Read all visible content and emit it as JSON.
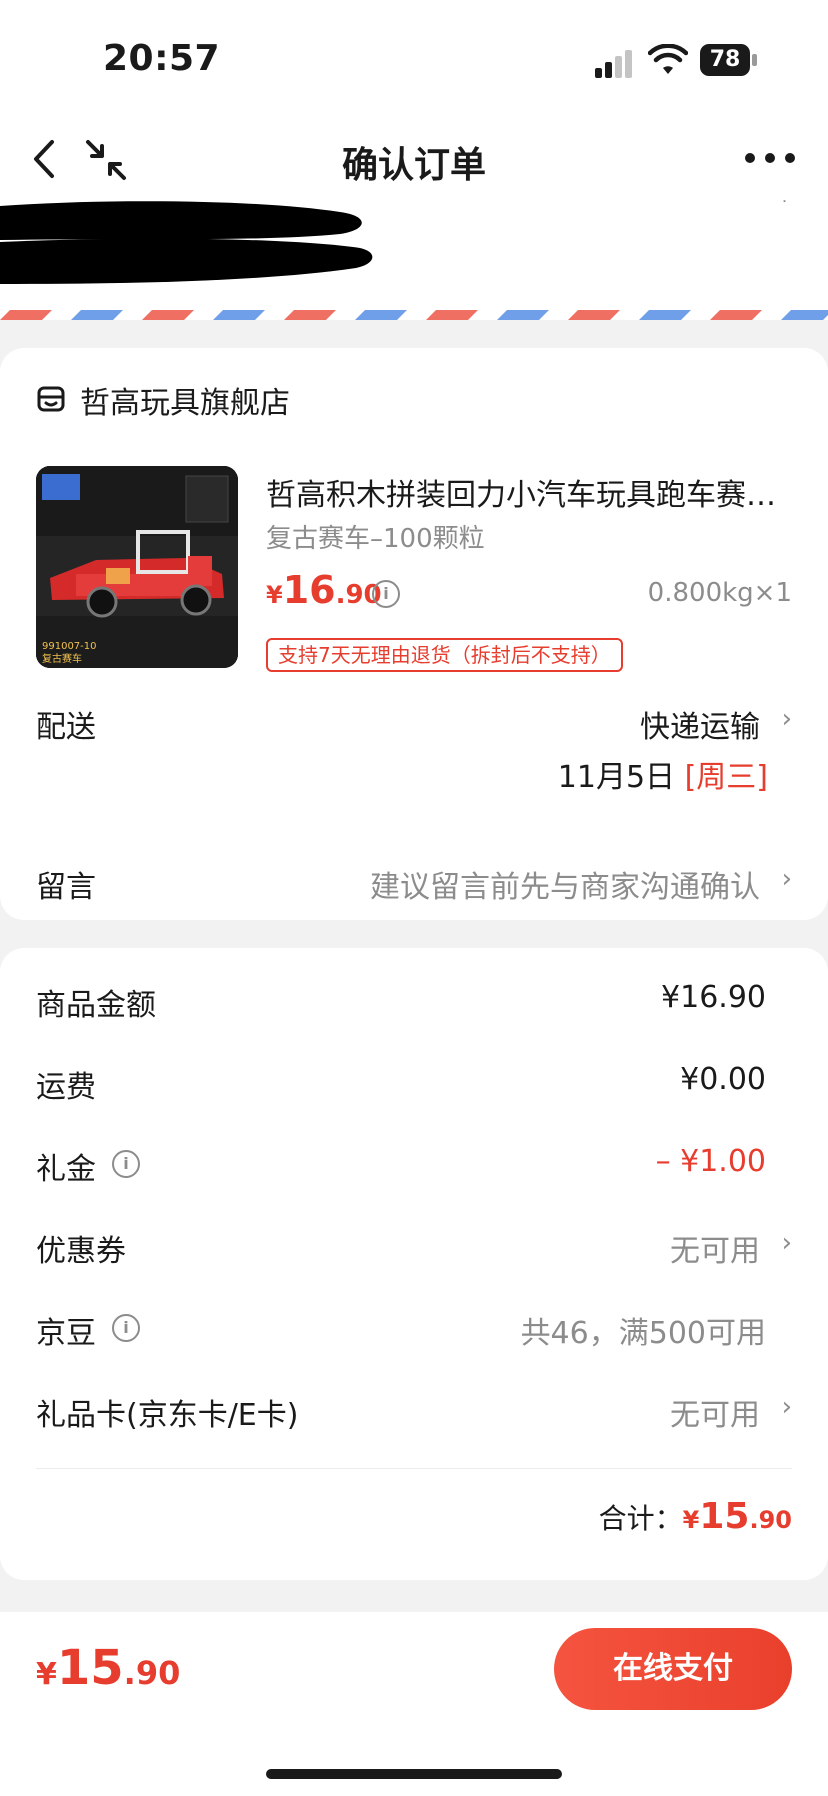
{
  "status_bar": {
    "time": "20:57",
    "battery": "78"
  },
  "header": {
    "title": "确认订单"
  },
  "shop": {
    "name": "哲高玩具旗舰店"
  },
  "product": {
    "title": "哲高积木拼装回力小汽车玩具跑车赛…",
    "spec": "复古赛车–100颗粒",
    "price_symbol": "¥",
    "price_int": "16",
    "price_dec": ".90",
    "weight_qty": "0.800kg×1",
    "return_policy": "支持7天无理由退货（拆封后不支持）",
    "image_text": {
      "code": "991007-10",
      "name": "复古赛车"
    }
  },
  "delivery": {
    "label": "配送",
    "method": "快递运输",
    "date": "11月5日",
    "weekday": "[周三]"
  },
  "message": {
    "label": "留言",
    "hint": "建议留言前先与商家沟通确认"
  },
  "summary": {
    "goods_amount": {
      "label": "商品金额",
      "value": "¥16.90"
    },
    "shipping": {
      "label": "运费",
      "value": "¥0.00"
    },
    "gift_money": {
      "label": "礼金",
      "value": "– ¥1.00"
    },
    "coupon": {
      "label": "优惠券",
      "value": "无可用"
    },
    "jingdou": {
      "label": "京豆",
      "value": "共46，满500可用"
    },
    "gift_card": {
      "label": "礼品卡(京东卡/E卡)",
      "value": "无可用"
    },
    "total_label": "合计：",
    "total_symbol": "¥",
    "total_int": "15",
    "total_dec": ".90"
  },
  "bottom_bar": {
    "price_symbol": "¥",
    "price_int": "15",
    "price_dec": ".90",
    "pay_label": "在线支付"
  },
  "colors": {
    "accent": "#e63d2e",
    "muted": "#8c8c8c",
    "background": "#f2f2f2"
  }
}
